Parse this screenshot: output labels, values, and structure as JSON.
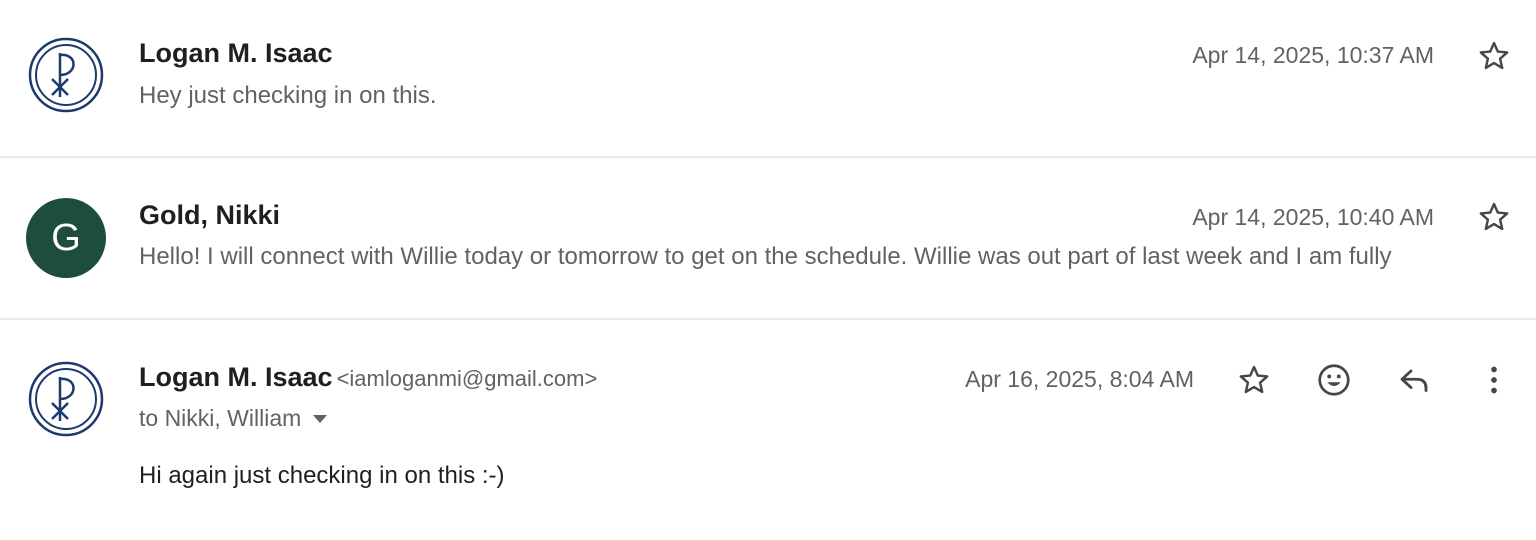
{
  "messages": [
    {
      "sender": "Logan M. Isaac",
      "snippet": "Hey just checking in on this.",
      "date": "Apr 14, 2025, 10:37 AM",
      "avatar": "chi-rho-logo-icon"
    },
    {
      "sender": "Gold, Nikki",
      "avatar_letter": "G",
      "avatar_color": "#1e4d40",
      "snippet": "Hello! I will connect with Willie today or tomorrow to get on the schedule. Willie was out part of last week and I am fully",
      "date": "Apr 14, 2025, 10:40 AM"
    },
    {
      "sender": "Logan M. Isaac",
      "email": "<iamloganmi@gmail.com>",
      "recipients": "to Nikki, William",
      "date": "Apr 16, 2025, 8:04 AM",
      "body": "Hi again just checking in on this :-)",
      "avatar": "chi-rho-logo-icon",
      "actions": [
        "star-icon",
        "emoji-reaction-icon",
        "reply-icon",
        "more-options-icon"
      ]
    }
  ],
  "colors": {
    "logo_blue": "#1c3a6e",
    "divider": "#e8eaed",
    "secondary_text": "#5f6368"
  }
}
